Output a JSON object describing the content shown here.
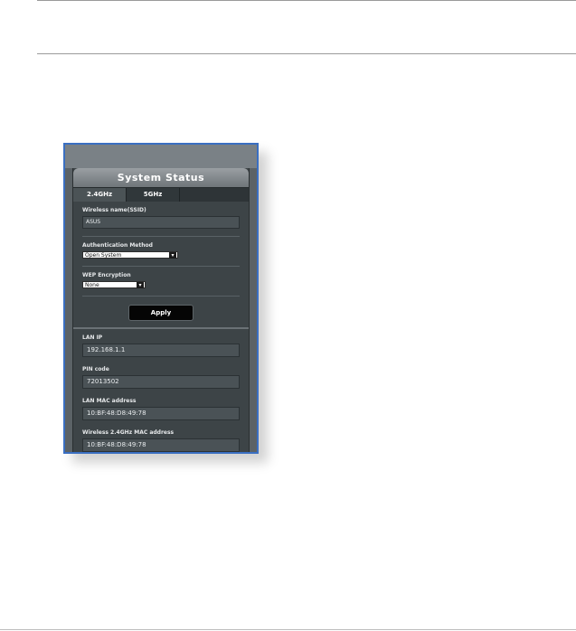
{
  "panel": {
    "title": "System Status",
    "tabs": [
      {
        "label": "2.4GHz"
      },
      {
        "label": "5GHz"
      }
    ]
  },
  "wireless": {
    "ssid_label": "Wireless name(SSID)",
    "ssid_value": "ASUS",
    "auth_label": "Authentication Method",
    "auth_value": "Open System",
    "wep_label": "WEP Encryption",
    "wep_value": "None",
    "apply_label": "Apply"
  },
  "status": {
    "lan_ip_label": "LAN IP",
    "lan_ip_value": "192.168.1.1",
    "pin_label": "PIN code",
    "pin_value": "72013502",
    "lan_mac_label": "LAN MAC address",
    "lan_mac_value": "10:BF:48:D8:49:78",
    "wlan_mac_label": "Wireless 2.4GHz MAC address",
    "wlan_mac_value": "10:BF:48:D8:49:78"
  },
  "colors": {
    "frame_border": "#3a6fc2",
    "panel_bg": "#3d4447",
    "button_bg": "#050505"
  },
  "icons": {
    "dropdown": "chevron-down-icon"
  }
}
